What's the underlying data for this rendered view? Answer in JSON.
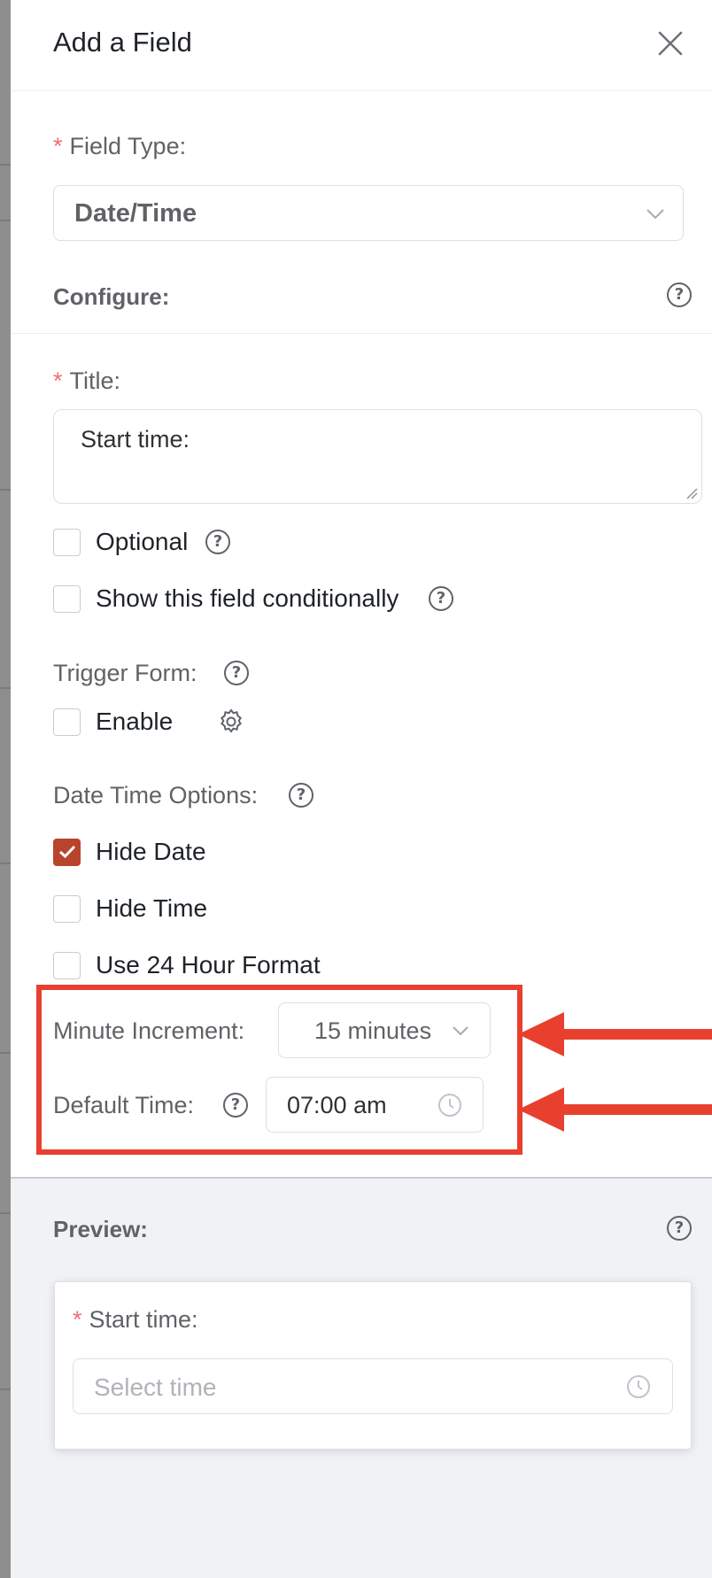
{
  "header": {
    "title": "Add a Field"
  },
  "field_type": {
    "required_mark": "*",
    "label": "Field Type:",
    "value": "Date/Time"
  },
  "configure": {
    "label": "Configure:"
  },
  "title_field": {
    "required_mark": "*",
    "label": "Title:",
    "value": "Start time:"
  },
  "optional": {
    "label": "Optional",
    "checked": false
  },
  "conditional": {
    "label": "Show this field conditionally",
    "checked": false
  },
  "trigger_form": {
    "label": "Trigger Form:",
    "enable_label": "Enable",
    "checked": false
  },
  "date_time_options": {
    "label": "Date Time Options:",
    "options": [
      {
        "label": "Hide Date",
        "checked": true
      },
      {
        "label": "Hide Time",
        "checked": false
      },
      {
        "label": "Use 24 Hour Format",
        "checked": false
      }
    ]
  },
  "minute_increment": {
    "label": "Minute Increment:",
    "value": "15 minutes"
  },
  "default_time": {
    "label": "Default Time:",
    "value": "07:00 am"
  },
  "preview": {
    "label": "Preview:",
    "field_required_mark": "*",
    "field_label": "Start time:",
    "placeholder": "Select time"
  },
  "colors": {
    "accent": "#b8442e",
    "highlight": "#e8402f",
    "required": "#f56c6c"
  },
  "icons": [
    "close-icon",
    "help-icon",
    "chevron-down-icon",
    "gear-icon",
    "clock-icon",
    "check-icon",
    "arrow-left-icon",
    "resize-grip-icon"
  ]
}
